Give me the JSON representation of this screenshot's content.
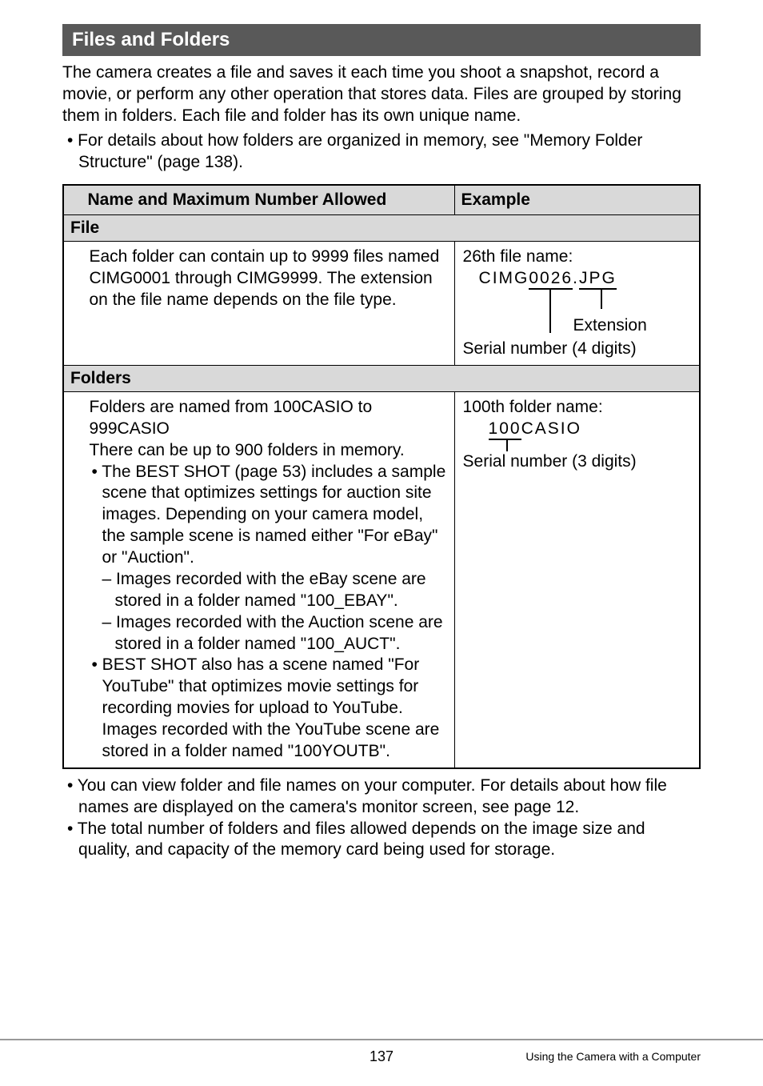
{
  "section_title": "Files and Folders",
  "intro_text": "The camera creates a file and saves it each time you shoot a snapshot, record a movie, or perform any other operation that stores data. Files are grouped by storing them in folders. Each file and folder has its own unique name.",
  "intro_bullet": "• For details about how folders are organized in memory, see \"Memory Folder Structure\" (page 138).",
  "table": {
    "header_col1": "Name and Maximum Number Allowed",
    "header_col2": "Example",
    "file_label": "File",
    "file_desc": "Each folder can contain up to 9999 files named CIMG0001 through CIMG9999. The extension on the file name depends on the file type.",
    "file_example_label": "26th file name:",
    "filename_prefix": "CIMG",
    "filename_num": "0026",
    "filename_dot": ".",
    "filename_ext": "JPG",
    "ext_label": "Extension",
    "serial4_label": "Serial number (4 digits)",
    "folders_label": "Folders",
    "folder_desc_line1": "Folders are named from 100CASIO to 999CASIO",
    "folder_desc_line2": "There can be up to 900 folders in memory.",
    "folder_bullet1": "• The BEST SHOT (page 53) includes a sample scene that optimizes settings for auction site images. Depending on your camera model, the sample scene is named either \"For eBay\" or \"Auction\".",
    "folder_dash1": "– Images recorded with the eBay scene are stored in a folder named \"100_EBAY\".",
    "folder_dash2": "– Images recorded with the Auction scene are stored in a folder named \"100_AUCT\".",
    "folder_bullet2": "• BEST SHOT also has a scene named \"For YouTube\" that optimizes movie settings for recording movies for upload to YouTube. Images recorded with the YouTube scene are stored in a folder named \"100YOUTB\".",
    "folder_example_label": "100th folder name:",
    "foldername_num": "100",
    "foldername_suffix": "CASIO",
    "serial3_label": "Serial number (3 digits)"
  },
  "post_bullet1": "• You can view folder and file names on your computer. For details about how file names are displayed on the camera's monitor screen, see page 12.",
  "post_bullet2": "• The total number of folders and files allowed depends on the image size and quality, and capacity of the memory card being used for storage.",
  "page_number": "137",
  "footer_right": "Using the Camera with a Computer"
}
